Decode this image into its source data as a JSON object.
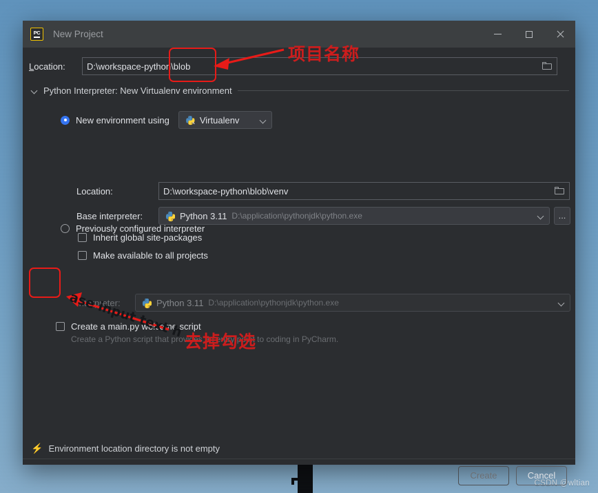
{
  "desktop": {
    "watermark": "CSDN @wltian"
  },
  "dialog": {
    "title": "New Project",
    "app_icon": "pycharm-icon",
    "icon_text": "PC",
    "window_controls": {
      "minimize": "minimize-icon",
      "maximize": "maximize-icon",
      "close": "close-icon"
    },
    "location": {
      "label": "Location:",
      "value": "D:\\workspace-python\\blob",
      "browse_icon": "folder-icon"
    },
    "section": {
      "header": "Python Interpreter: New Virtualenv environment",
      "collapse_icon": "chevron-down-icon"
    },
    "new_env": {
      "radio_label": "New environment using",
      "selected": true,
      "tool": "Virtualenv",
      "tool_icon": "virtualenv-icon",
      "dropdown_icon": "chevron-down-icon"
    },
    "venv_location": {
      "label": "Location:",
      "value": "D:\\workspace-python\\blob\\venv",
      "browse_icon": "folder-icon"
    },
    "base_interpreter": {
      "label": "Base interpreter:",
      "name": "Python 3.11",
      "path": "D:\\application\\pythonjdk\\python.exe",
      "icon": "python-icon",
      "dropdown_icon": "chevron-down-icon",
      "more_button": "..."
    },
    "checkboxes": [
      {
        "label": "Inherit global site-packages",
        "checked": false
      },
      {
        "label": "Make available to all projects",
        "checked": false
      }
    ],
    "previous_env": {
      "radio_label": "Previously configured interpreter",
      "selected": false,
      "interpreter_label": "Interpreter:",
      "interpreter_name": "Python 3.11",
      "interpreter_path": "D:\\application\\pythonjdk\\python.exe",
      "icon": "python-icon",
      "dropdown_icon": "chevron-down-icon"
    },
    "main_py": {
      "label": "Create a main.py welcome script",
      "checked": false,
      "description": "Create a Python script that provides an entry point to coding in PyCharm."
    },
    "status": {
      "icon": "warning-bolt-icon",
      "message": "Environment location directory is not empty"
    },
    "footer": {
      "create_label": "Create",
      "create_disabled": true,
      "cancel_label": "Cancel"
    }
  },
  "annotations": {
    "project_name_label": "项目名称",
    "uncheck_label": "去掉勾选",
    "overlay_text": "ase input text h",
    "color": "#cc1d1d"
  }
}
